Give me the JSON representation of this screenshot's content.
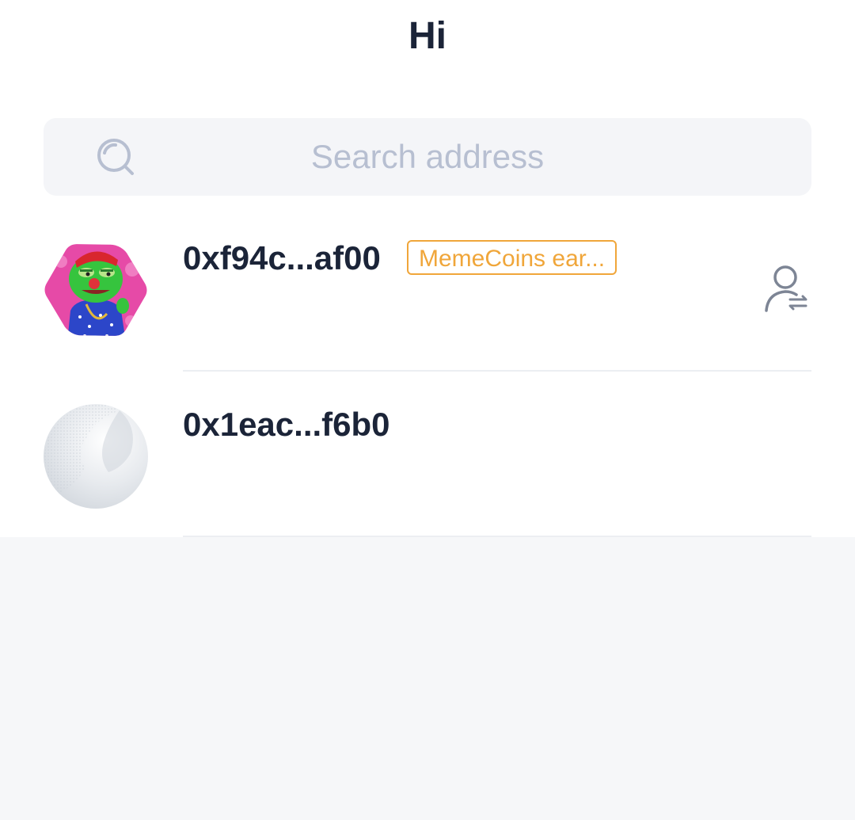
{
  "header": {
    "title": "Hi"
  },
  "search": {
    "placeholder": "Search address",
    "icon": "search-icon"
  },
  "accounts": [
    {
      "address": "0xf94c...af00",
      "tag": "MemeCoins ear...",
      "avatar": "nft-frog-avatar",
      "action_icon": "switch-account-icon"
    },
    {
      "address": "0x1eac...f6b0",
      "avatar": "default-avatar"
    }
  ],
  "colors": {
    "title": "#1b2438",
    "placeholder": "#b7bfd1",
    "badge": "#f0a63a",
    "search_bg": "#f4f5f8",
    "page_bg": "#f6f7f9"
  }
}
